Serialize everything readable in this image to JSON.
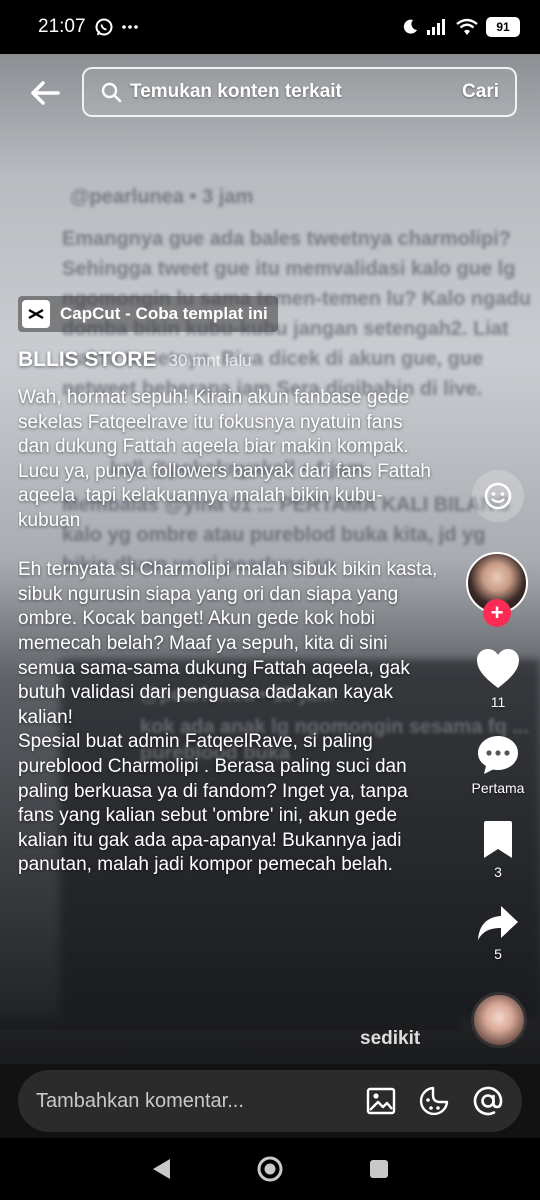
{
  "status_bar": {
    "time": "21:07",
    "battery": "91"
  },
  "search": {
    "placeholder": "Temukan konten terkait",
    "button": "Cari"
  },
  "capcut": {
    "label": "CapCut - Coba templat ini"
  },
  "post": {
    "author": "BLLIS STORE",
    "time": "30 mnt lalu",
    "caption": "Wah, hormat sepuh! Kirain akun fanbase gede sekelas Fatqeelrave itu fokusnya nyatuin fans dan dukung Fattah aqeela biar makin kompak.\nLucu ya, punya followers banyak dari fans Fattah aqeela  tapi kelakuannya malah bikin kubu-kubuan\n\nEh ternyata si Charmolipi malah sibuk bikin kasta, sibuk ngurusin siapa yang ori dan siapa yang ombre. Kocak banget! Akun gede kok hobi memecah belah? Maaf ya sepuh, kita di sini semua sama-sama dukung Fattah aqeela, gak butuh validasi dari penguasa dadakan kayak kalian!\nSpesial buat admin FatqeelRave, si paling pureblood Charmolipi . Berasa paling suci dan paling berkuasa ya di fandom? Inget ya, tanpa fans yang kalian sebut 'ombre' ini, akun gede kalian itu gak ada apa-apanya! Bukannya jadi panutan, malah jadi kompor pemecah belah.",
    "less_label": "sedikit"
  },
  "rail": {
    "likes": "11",
    "comments_label": "Pertama",
    "bookmarks": "3",
    "shares": "5"
  },
  "comment_bar": {
    "placeholder": "Tambahkan komentar..."
  },
  "colors": {
    "accent": "#fe2c55",
    "comment_bar_bg": "#2b2b2b"
  },
  "icons": [
    "back-arrow-icon",
    "search-icon",
    "emoji-icon",
    "heart-icon",
    "comment-icon",
    "bookmark-icon",
    "share-icon",
    "image-icon",
    "sticker-icon",
    "mention-icon"
  ]
}
